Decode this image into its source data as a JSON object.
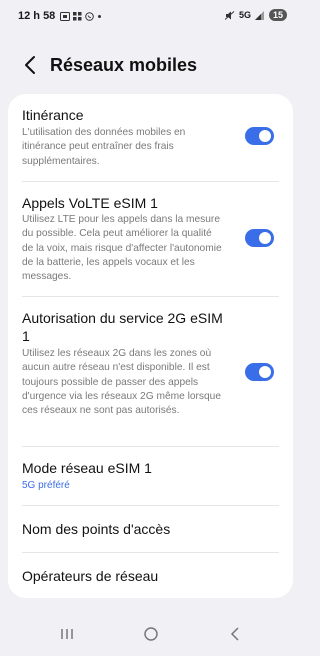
{
  "status_bar": {
    "time": "12 h 58",
    "network": "5G",
    "battery": "15",
    "icons": [
      "screenshot-icon",
      "grid-icon",
      "whatsapp-icon",
      "dot-icon",
      "mute-icon",
      "signal-icon"
    ]
  },
  "header": {
    "title": "Réseaux mobiles",
    "back_icon": "chevron-left-icon"
  },
  "settings": {
    "roaming": {
      "title": "Itinérance",
      "description": "L'utilisation des données mobiles en itinérance peut entraîner des frais supplémentaires.",
      "enabled": true
    },
    "volte": {
      "title": "Appels VoLTE eSIM 1",
      "description": "Utilisez LTE pour les appels dans la mesure du possible. Cela peut améliorer la qualité de la voix, mais risque d'affecter l'autonomie de la batterie, les appels vocaux et les messages.",
      "enabled": true
    },
    "service_2g": {
      "title": "Autorisation du service 2G eSIM 1",
      "description": "Utilisez les réseaux 2G dans les zones où aucun autre réseau n'est disponible. Il est toujours possible de passer des appels d'urgence via les réseaux 2G même lorsque ces réseaux ne sont pas autorisés.",
      "enabled": true
    },
    "network_mode": {
      "title": "Mode réseau eSIM 1",
      "value": "5G préféré"
    },
    "access_points": {
      "title": "Nom des points d'accès"
    },
    "operators": {
      "title": "Opérateurs de réseau"
    }
  },
  "colors": {
    "accent": "#3a6ee8",
    "background": "#f1f1f5",
    "card": "#ffffff"
  },
  "nav_bar": {
    "icons": [
      "recents-icon",
      "home-icon",
      "back-icon"
    ]
  }
}
